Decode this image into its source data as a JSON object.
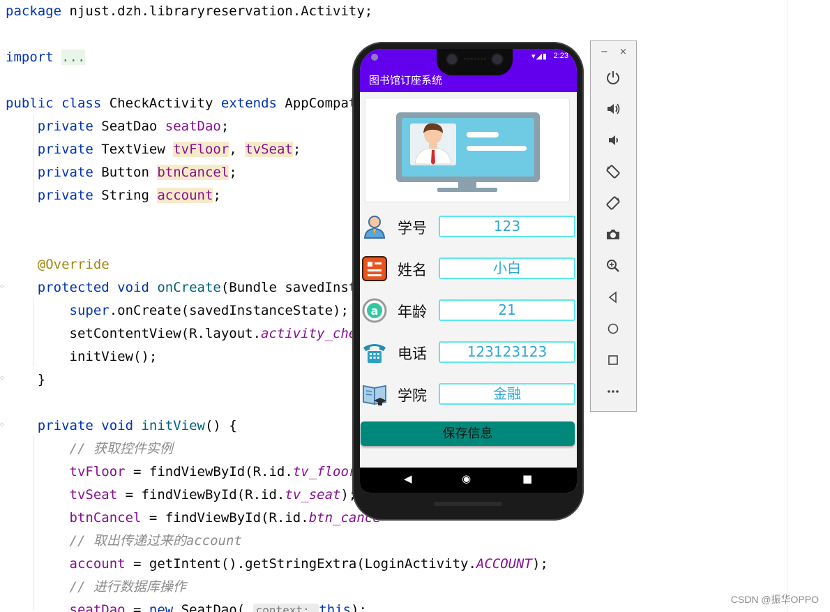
{
  "editor": {
    "lines": [
      {
        "segments": [
          {
            "t": "package ",
            "c": "kw"
          },
          {
            "t": "njust.dzh.libraryreservation.Activity;",
            "c": ""
          }
        ]
      },
      {
        "segments": []
      },
      {
        "segments": [
          {
            "t": "import ",
            "c": "kw"
          },
          {
            "t": "...",
            "c": "fold"
          }
        ]
      },
      {
        "segments": []
      },
      {
        "segments": [
          {
            "t": "public class ",
            "c": "kw"
          },
          {
            "t": "CheckActivity ",
            "c": ""
          },
          {
            "t": "extends ",
            "c": "kw"
          },
          {
            "t": "AppCompatA",
            "c": ""
          }
        ]
      },
      {
        "segments": [
          {
            "t": "    private ",
            "c": "kw"
          },
          {
            "t": "SeatDao ",
            "c": ""
          },
          {
            "t": "seatDao",
            "c": "field"
          },
          {
            "t": ";",
            "c": ""
          }
        ]
      },
      {
        "segments": [
          {
            "t": "    private ",
            "c": "kw"
          },
          {
            "t": "TextView ",
            "c": ""
          },
          {
            "t": "tvFloor",
            "c": "field hl"
          },
          {
            "t": ", ",
            "c": ""
          },
          {
            "t": "tvSeat",
            "c": "field hl"
          },
          {
            "t": ";",
            "c": ""
          }
        ]
      },
      {
        "segments": [
          {
            "t": "    private ",
            "c": "kw"
          },
          {
            "t": "Button ",
            "c": ""
          },
          {
            "t": "btnCancel",
            "c": "field hl"
          },
          {
            "t": ";",
            "c": ""
          }
        ]
      },
      {
        "segments": [
          {
            "t": "    private ",
            "c": "kw"
          },
          {
            "t": "String ",
            "c": ""
          },
          {
            "t": "account",
            "c": "field hl"
          },
          {
            "t": ";",
            "c": ""
          }
        ]
      },
      {
        "segments": []
      },
      {
        "segments": []
      },
      {
        "segments": [
          {
            "t": "    @Override",
            "c": "ann"
          }
        ]
      },
      {
        "segments": [
          {
            "t": "    protected void ",
            "c": "kw"
          },
          {
            "t": "onCreate",
            "c": "fn"
          },
          {
            "t": "(Bundle savedInsta",
            "c": ""
          }
        ]
      },
      {
        "segments": [
          {
            "t": "        super",
            "c": "kw"
          },
          {
            "t": ".onCreate(savedInstanceState);",
            "c": ""
          }
        ]
      },
      {
        "segments": [
          {
            "t": "        setContentView(R.layout.",
            "c": ""
          },
          {
            "t": "activity_chec",
            "c": "field-italic"
          }
        ]
      },
      {
        "segments": [
          {
            "t": "        initView();",
            "c": ""
          }
        ]
      },
      {
        "segments": [
          {
            "t": "    }",
            "c": ""
          }
        ]
      },
      {
        "segments": []
      },
      {
        "segments": [
          {
            "t": "    private void ",
            "c": "kw"
          },
          {
            "t": "initView",
            "c": "fn"
          },
          {
            "t": "() {",
            "c": ""
          }
        ]
      },
      {
        "segments": [
          {
            "t": "        // 获取控件实例",
            "c": "cmt"
          }
        ]
      },
      {
        "segments": [
          {
            "t": "        tvFloor",
            "c": "field"
          },
          {
            "t": " = findViewById(R.id.",
            "c": ""
          },
          {
            "t": "tv_floor",
            "c": "field-italic"
          }
        ]
      },
      {
        "segments": [
          {
            "t": "        tvSeat",
            "c": "field"
          },
          {
            "t": " = findViewById(R.id.",
            "c": ""
          },
          {
            "t": "tv_seat",
            "c": "field-italic"
          },
          {
            "t": ");",
            "c": ""
          }
        ]
      },
      {
        "segments": [
          {
            "t": "        btnCancel",
            "c": "field"
          },
          {
            "t": " = findViewById(R.id.",
            "c": ""
          },
          {
            "t": "btn_cance",
            "c": "field-italic"
          }
        ]
      },
      {
        "segments": [
          {
            "t": "        // 取出传递过来的account",
            "c": "cmt"
          }
        ]
      },
      {
        "segments": [
          {
            "t": "        account",
            "c": "field"
          },
          {
            "t": " = getIntent().getStringExtra(LoginActivity.",
            "c": ""
          },
          {
            "t": "ACCOUNT",
            "c": "field-italic"
          },
          {
            "t": ");",
            "c": ""
          }
        ]
      },
      {
        "segments": [
          {
            "t": "        // 进行数据库操作",
            "c": "cmt"
          }
        ]
      },
      {
        "segments": [
          {
            "t": "        seatDao",
            "c": "field"
          },
          {
            "t": " = ",
            "c": ""
          },
          {
            "t": "new ",
            "c": "kw"
          },
          {
            "t": "SeatDao( ",
            "c": ""
          },
          {
            "t": "context: ",
            "c": "hint"
          },
          {
            "t": "this",
            "c": "kw"
          },
          {
            "t": ");",
            "c": ""
          }
        ]
      }
    ],
    "watermark": "CSDN @振华OPPO"
  },
  "phone": {
    "status_time": "2:23",
    "app_title": "图书馆订座系统",
    "rows": [
      {
        "label": "学号",
        "value": "123",
        "icon": "student-icon"
      },
      {
        "label": "姓名",
        "value": "小白",
        "icon": "id-card-icon"
      },
      {
        "label": "年龄",
        "value": "21",
        "icon": "age-icon"
      },
      {
        "label": "电话",
        "value": "123123123",
        "icon": "telephone-icon"
      },
      {
        "label": "学院",
        "value": "金融",
        "icon": "college-icon"
      }
    ],
    "save_label": "保存信息",
    "nav": {
      "back": "◀",
      "home": "◉",
      "recents": "■"
    }
  },
  "toolbar": {
    "minimize": "−",
    "close": "×",
    "buttons": [
      "power-icon",
      "volume-up-icon",
      "volume-down-icon",
      "rotate-left-icon",
      "rotate-right-icon",
      "camera-icon",
      "zoom-icon",
      "back-icon",
      "home-icon",
      "overview-icon",
      "more-icon"
    ]
  },
  "colors": {
    "app_bar": "#6200ee",
    "save_button": "#00897b",
    "field_border": "#5ce8f0",
    "field_text": "#2ea8d8"
  }
}
